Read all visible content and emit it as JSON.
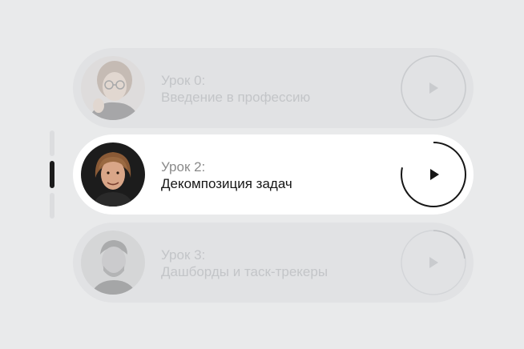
{
  "lessons": [
    {
      "number": "Урок 0:",
      "title": "Введение в профессию",
      "state": "dim",
      "avatar": "woman-with-glasses"
    },
    {
      "number": "Урок 2:",
      "title": "Декомпозиция задач",
      "state": "active",
      "avatar": "young-man"
    },
    {
      "number": "Урок 3:",
      "title": "Дашборды и таск-трекеры",
      "state": "dim",
      "avatar": "man-with-beard"
    }
  ],
  "icons": {
    "play": "play-icon"
  },
  "colors": {
    "background": "#e9eaeb",
    "accent": "#161616",
    "muted": "#c3c5c8"
  }
}
